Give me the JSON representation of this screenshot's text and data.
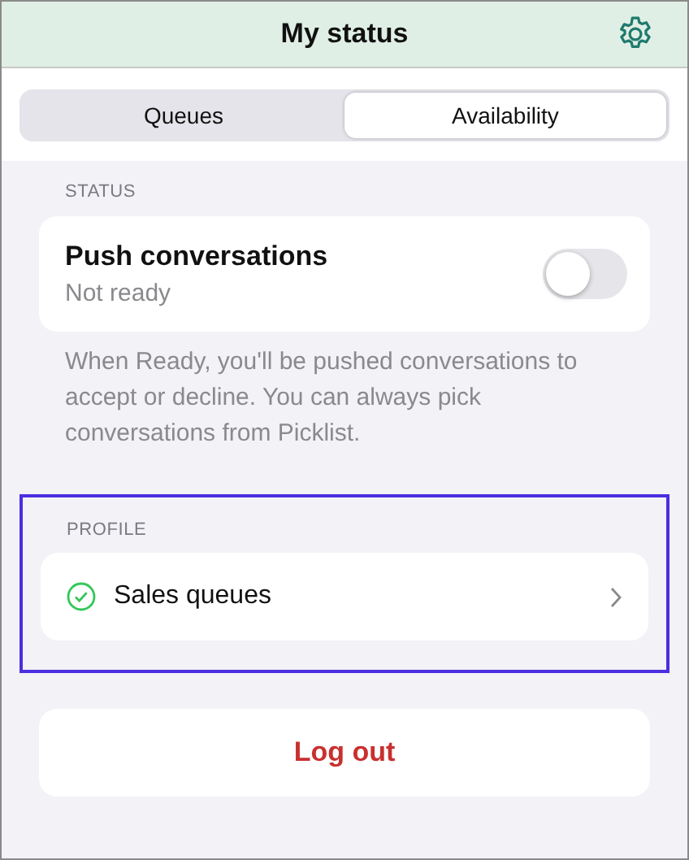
{
  "header": {
    "title": "My status"
  },
  "tabs": [
    {
      "label": "Queues",
      "selected": false
    },
    {
      "label": "Availability",
      "selected": true
    }
  ],
  "status": {
    "heading": "STATUS",
    "title": "Push conversations",
    "subtitle": "Not ready",
    "on": false,
    "note": "When Ready, you'll be pushed conversations to accept or decline. You can always pick conversations from Picklist."
  },
  "profile": {
    "heading": "PROFILE",
    "highlighted": true,
    "item": {
      "label": "Sales queues",
      "checked": true
    }
  },
  "logout": {
    "label": "Log out"
  }
}
